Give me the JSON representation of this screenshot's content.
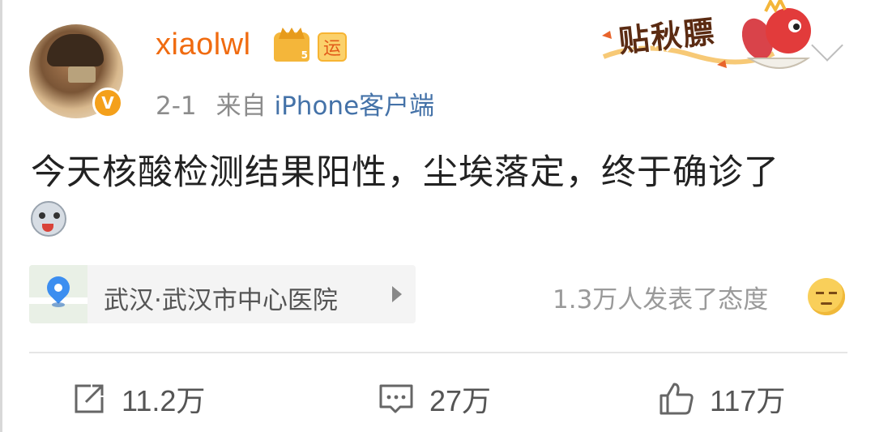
{
  "post": {
    "username": "xiaolwl",
    "vip_badge_level": "5",
    "luck_badge": "运",
    "time": "2-1",
    "source_prefix": "来自",
    "source": "iPhone客户端",
    "text": "今天核酸检测结果阳性，尘埃落定，终于确诊了",
    "sticker_text": "贴秋膘",
    "location": "武汉·武汉市中心医院",
    "reactions": "1.3万人发表了态度"
  },
  "actions": {
    "repost_count": "11.2万",
    "comment_count": "27万",
    "like_count": "117万"
  },
  "colors": {
    "username": "#f06b10",
    "source_link": "#4472a8",
    "verified_badge": "#f4a01b",
    "location_pin": "#3c8ef0"
  },
  "icons": [
    "verified-v-icon",
    "vip-crown-icon",
    "luck-badge-icon",
    "chevron-down-icon",
    "sad-face-emoji-icon",
    "location-pin-icon",
    "play-arrow-icon",
    "reaction-emoji-icon",
    "repost-icon",
    "comment-icon",
    "like-icon"
  ]
}
